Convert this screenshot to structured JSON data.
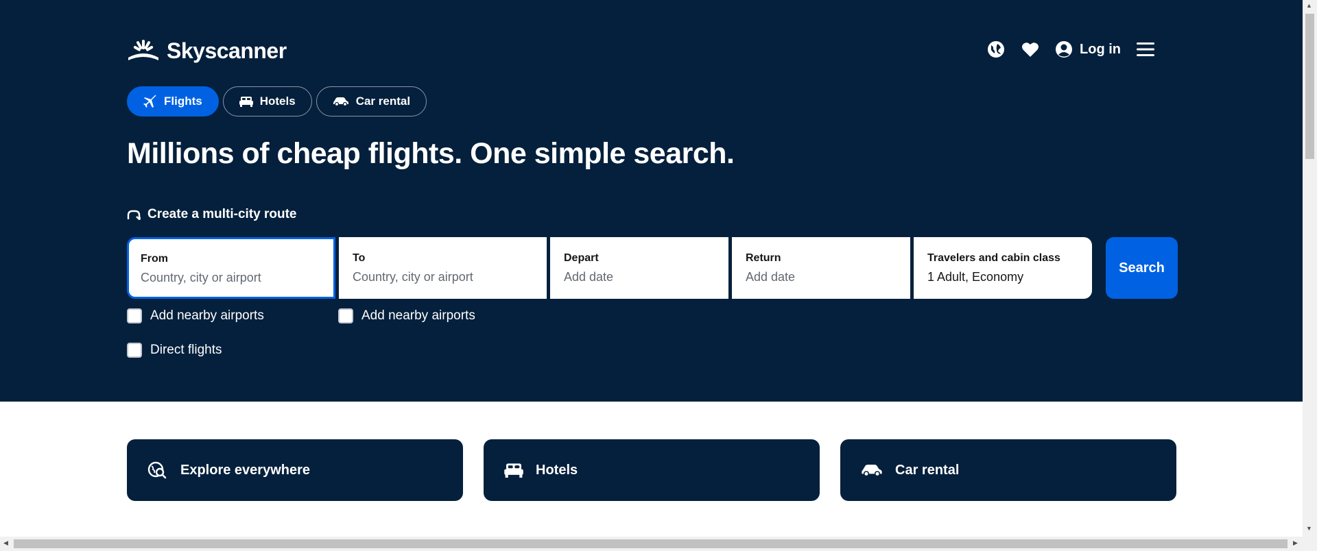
{
  "header": {
    "brand": "Skyscanner",
    "login_label": "Log in",
    "icons": [
      "globe-icon",
      "heart-icon",
      "user-icon",
      "menu-icon"
    ]
  },
  "tabs": [
    {
      "label": "Flights",
      "icon": "plane-icon",
      "active": true
    },
    {
      "label": "Hotels",
      "icon": "bed-icon",
      "active": false
    },
    {
      "label": "Car rental",
      "icon": "car-icon",
      "active": false
    }
  ],
  "headline": "Millions of cheap flights. One simple search.",
  "multicity_label": "Create a multi-city route",
  "search": {
    "from": {
      "label": "From",
      "placeholder": "Country, city or airport"
    },
    "to": {
      "label": "To",
      "placeholder": "Country, city or airport"
    },
    "depart": {
      "label": "Depart",
      "placeholder": "Add date"
    },
    "return": {
      "label": "Return",
      "placeholder": "Add date"
    },
    "travelers": {
      "label": "Travelers and cabin class",
      "value": "1 Adult, Economy"
    },
    "button_label": "Search"
  },
  "options": {
    "from_nearby": "Add nearby airports",
    "to_nearby": "Add nearby airports",
    "direct": "Direct flights"
  },
  "cards": [
    {
      "label": "Explore everywhere",
      "icon": "explore-icon"
    },
    {
      "label": "Hotels",
      "icon": "bed-icon"
    },
    {
      "label": "Car rental",
      "icon": "car-icon"
    }
  ],
  "colors": {
    "hero_bg": "#05203c",
    "accent": "#0062e3",
    "page_bg": "#ffffff"
  }
}
